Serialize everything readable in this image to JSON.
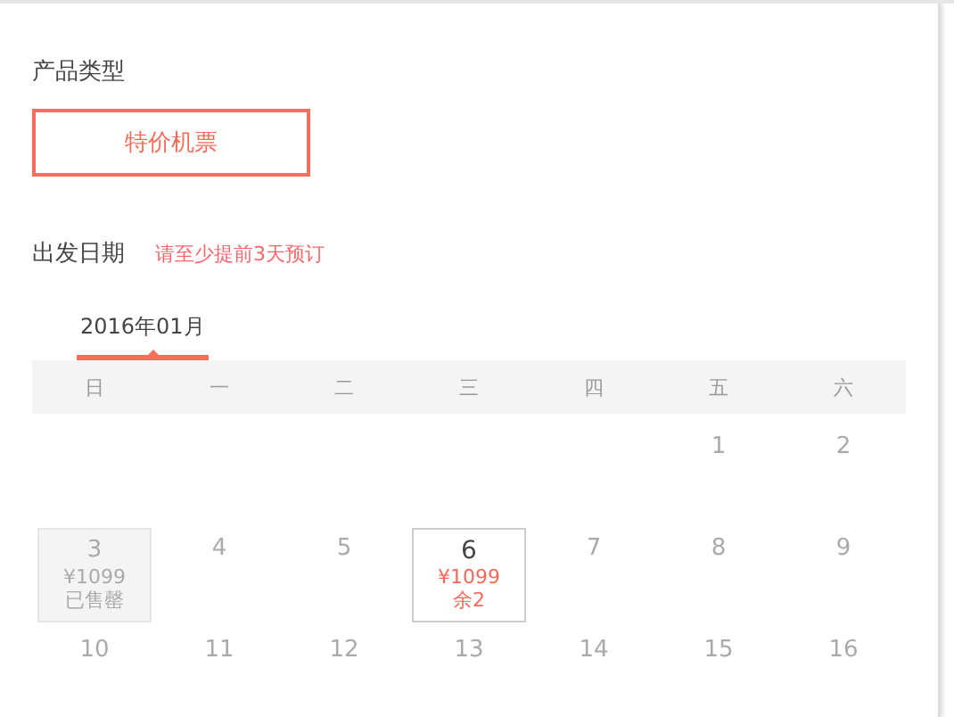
{
  "product": {
    "title": "产品类型",
    "options": [
      {
        "label": "特价机票",
        "selected": true
      }
    ]
  },
  "departure": {
    "title": "出发日期",
    "hint": "请至少提前3天预订"
  },
  "calendar": {
    "months": [
      {
        "label": "2016年01月",
        "selected": true
      }
    ],
    "weekdays": [
      "日",
      "一",
      "二",
      "三",
      "四",
      "五",
      "六"
    ],
    "weeks": [
      [
        {
          "kind": "blank"
        },
        {
          "kind": "blank"
        },
        {
          "kind": "blank"
        },
        {
          "kind": "blank"
        },
        {
          "kind": "blank"
        },
        {
          "kind": "plain",
          "day": "1"
        },
        {
          "kind": "plain",
          "day": "2"
        }
      ],
      [
        {
          "kind": "sold_out",
          "day": "3",
          "price": "¥1099",
          "note": "已售罄"
        },
        {
          "kind": "plain",
          "day": "4"
        },
        {
          "kind": "plain",
          "day": "5"
        },
        {
          "kind": "available",
          "day": "6",
          "price": "¥1099",
          "note": "余2"
        },
        {
          "kind": "plain",
          "day": "7"
        },
        {
          "kind": "plain",
          "day": "8"
        },
        {
          "kind": "plain",
          "day": "9"
        }
      ],
      [
        {
          "kind": "plain",
          "day": "10"
        },
        {
          "kind": "plain",
          "day": "11"
        },
        {
          "kind": "plain",
          "day": "12"
        },
        {
          "kind": "plain",
          "day": "13"
        },
        {
          "kind": "plain",
          "day": "14"
        },
        {
          "kind": "plain",
          "day": "15"
        },
        {
          "kind": "plain",
          "day": "16"
        }
      ]
    ]
  }
}
